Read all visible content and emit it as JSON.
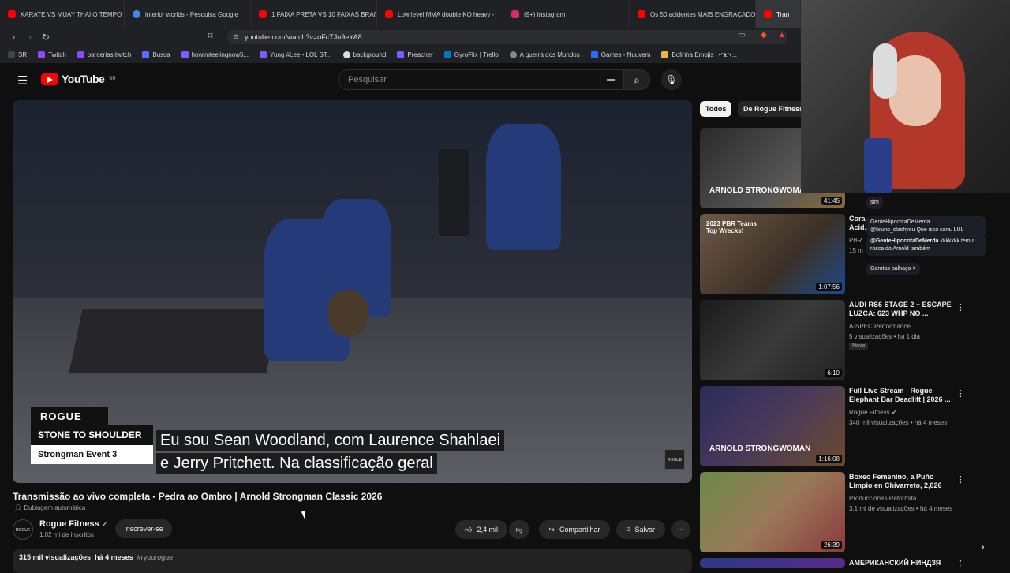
{
  "browser": {
    "tabs": [
      {
        "label": "KARATE VS MUAY THAI O TEMPO É",
        "color": "#ff0000"
      },
      {
        "label": "interior worlds - Pesquisa Google",
        "color": "#4285f4"
      },
      {
        "label": "1 FAIXA PRETA VS 10 FAIXAS BRAN",
        "color": "#ff0000"
      },
      {
        "label": "Low level MMA double KO heavy -",
        "color": "#ff0000"
      },
      {
        "label": "(9+) Instagram",
        "color": "#d62976"
      },
      {
        "label": "Os 50 acidentes MAIS ENGRAÇADO",
        "color": "#ff0000"
      },
      {
        "label": "Tran",
        "color": "#ff0000"
      }
    ],
    "url": "youtube.com/watch?v=oFcTJu9eYA8",
    "bookmarks": [
      "SR",
      "Twitch",
      "parcerias twitch",
      "Busca",
      "howimfeelingnow5...",
      "Yung #Lee - LOL ST...",
      "background",
      "Preacher",
      "GyroFlix | Trello",
      "A guerra dos Mundos",
      "Games - Nuuvem",
      "Bolinha Emojis | •ᵔᴥᵔ•..."
    ]
  },
  "header": {
    "logo_text": "YouTube",
    "country": "BR",
    "search_placeholder": "Pesquisar"
  },
  "video": {
    "card_brand": "ROGUE",
    "card_event": "STONE TO SHOULDER",
    "card_sub": "Strongman Event 3",
    "caption_line1": "Eu sou Sean Woodland, com Laurence Shahlaei",
    "caption_line2": "e Jerry Pritchett.  Na classificação geral",
    "watermark": "ROGUE"
  },
  "info": {
    "title": "Transmissão ao vivo completa - Pedra ao Ombro | Arnold Strongman Classic 2026",
    "dubbing": "Dublagem automática",
    "channel": "Rogue Fitness",
    "avatar_text": "ROGUE",
    "subscribers": "1,02 mi de inscritos",
    "subscribe_label": "Inscrever-se",
    "likes": "2,4 mil",
    "share_label": "Compartilhar",
    "save_label": "Salvar",
    "views": "315 mil visualizações",
    "age": "há 4 meses",
    "hashtag": "#ryourogue"
  },
  "chips": [
    "Todos",
    "De Rogue Fitness"
  ],
  "recommendations": [
    {
      "title": "",
      "channel": "",
      "meta": "",
      "duration": "41:45",
      "thumb_text": "ARNOLD STRONGWOMAN"
    },
    {
      "title": "Cora... Acid...",
      "channel": "PBR",
      "meta": "15 m",
      "duration": "1:07:56",
      "thumb_text": "2023 PBR Teams Top Wrecks!"
    },
    {
      "title": "AUDI RS6 STAGE 2 + ESCAPE LUZCA: 623 WHP NO ...",
      "channel": "A-SPEC Performance",
      "meta": "5 visualizações • há 1 dia",
      "duration": "6:10",
      "badge": "Novo",
      "thumb_text": ""
    },
    {
      "title": "Full Live Stream - Rogue Elephant Bar Deadlift | 2026 ...",
      "channel": "Rogue Fitness",
      "meta": "340 mil visualizações • há 4 meses",
      "duration": "1:16:08",
      "thumb_text": "ARNOLD STRONGWOMAN"
    },
    {
      "title": "Boxeo Femenino, a Puño Limpio en Chivarreto,  2,026",
      "channel": "Producciones Reformita",
      "meta": "3,1 mi de visualizações • há 4 meses",
      "duration": "26:39",
      "thumb_text": ""
    },
    {
      "title": "АМЕРИКАНСКИЙ НИНДЗЯ",
      "channel": "",
      "meta": "",
      "duration": "",
      "thumb_text": ""
    }
  ],
  "chat": [
    {
      "text": "sim"
    },
    {
      "user": "GenteHipocritaDeMerda",
      "text": "@bruno_slashyou Que isso cara. LUL"
    },
    {
      "user": "@GenteHipocritaDeMerda",
      "text": "kkkkkkk tem a rosca do Arnold também"
    },
    {
      "text": "Garotas palhaço->"
    }
  ],
  "colors": {
    "yt_red": "#ff0000",
    "bg": "#0f0f0f"
  }
}
